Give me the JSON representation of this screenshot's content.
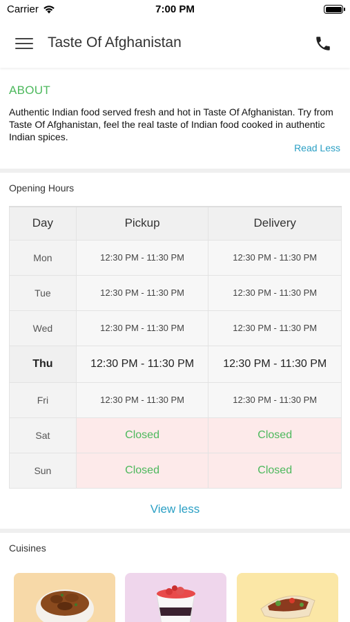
{
  "status_bar": {
    "carrier": "Carrier",
    "time": "7:00 PM"
  },
  "header": {
    "title": "Taste Of Afghanistan"
  },
  "about": {
    "title": "ABOUT",
    "description": "Authentic Indian food served fresh and hot in Taste Of Afghanistan. Try from Taste Of Afghanistan, feel the real taste of Indian food cooked in authentic Indian spices.",
    "toggle_label": "Read Less"
  },
  "opening_hours": {
    "title": "Opening Hours",
    "columns": [
      "Day",
      "Pickup",
      "Delivery"
    ],
    "rows": [
      {
        "day": "Mon",
        "pickup": "12:30 PM - 11:30 PM",
        "delivery": "12:30 PM - 11:30 PM"
      },
      {
        "day": "Tue",
        "pickup": "12:30 PM - 11:30 PM",
        "delivery": "12:30 PM - 11:30 PM"
      },
      {
        "day": "Wed",
        "pickup": "12:30 PM - 11:30 PM",
        "delivery": "12:30 PM - 11:30 PM"
      },
      {
        "day": "Thu",
        "pickup": "12:30 PM - 11:30 PM",
        "delivery": "12:30 PM - 11:30 PM"
      },
      {
        "day": "Fri",
        "pickup": "12:30 PM - 11:30 PM",
        "delivery": "12:30 PM - 11:30 PM"
      },
      {
        "day": "Sat",
        "pickup": "Closed",
        "delivery": "Closed"
      },
      {
        "day": "Sun",
        "pickup": "Closed",
        "delivery": "Closed"
      }
    ],
    "toggle_label": "View less"
  },
  "cuisines": {
    "title": "Cuisines",
    "cards": [
      {
        "icon": "curry-bowl-icon",
        "color": "#f7d9a8"
      },
      {
        "icon": "dessert-parfait-icon",
        "color": "#efd6ec"
      },
      {
        "icon": "wrap-sandwich-icon",
        "color": "#fbe7a6"
      }
    ]
  },
  "colors": {
    "accent_green": "#4cb85c",
    "link_blue": "#2a9fc4",
    "closed_bg": "#fdeaea"
  }
}
